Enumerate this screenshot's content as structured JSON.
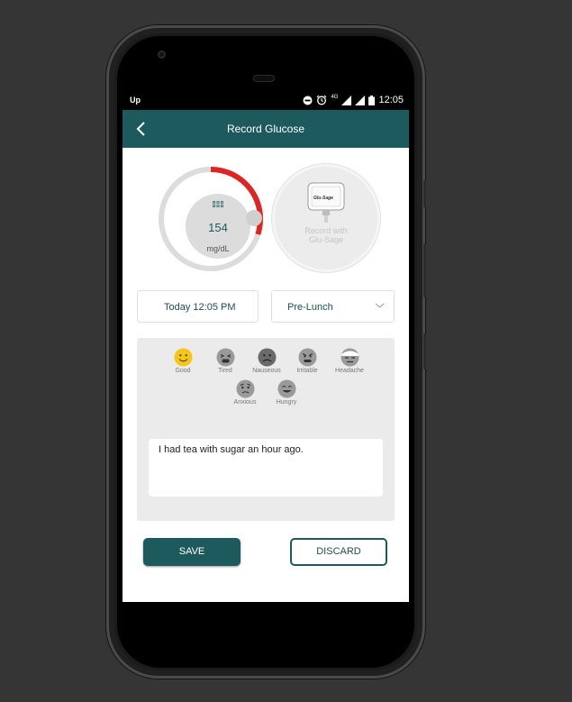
{
  "status_bar": {
    "app_badge": "Up",
    "network": "4G",
    "time": "12:05"
  },
  "app_bar": {
    "title": "Record Glucose",
    "back_icon": "chevron-left-icon"
  },
  "glucose": {
    "value": "154",
    "unit": "mg/dL",
    "level_fraction": 0.3,
    "accent_color": "#e02424",
    "track_color": "#dcdcdc"
  },
  "device": {
    "brand": "Glu-Sage",
    "label_line1": "Record with",
    "label_line2": "Glu-Sage"
  },
  "datetime": {
    "value": "Today 12:05 PM"
  },
  "meal": {
    "selected": "Pre-Lunch"
  },
  "moods": [
    {
      "label": "Good",
      "icon": "smile-icon",
      "color": "#f5c518"
    },
    {
      "label": "Tired",
      "icon": "tired-face-icon",
      "color": "#9a9a9a"
    },
    {
      "label": "Nauseous",
      "icon": "nauseous-face-icon",
      "color": "#6a6a6a"
    },
    {
      "label": "Irritable",
      "icon": "irritable-face-icon",
      "color": "#9a9a9a"
    },
    {
      "label": "Headache",
      "icon": "headache-face-icon",
      "color": "#9a9a9a"
    },
    {
      "label": "Anxious",
      "icon": "anxious-face-icon",
      "color": "#9a9a9a"
    },
    {
      "label": "Hungry",
      "icon": "hungry-face-icon",
      "color": "#9a9a9a"
    }
  ],
  "note": {
    "text": "I had tea with sugar an hour ago."
  },
  "actions": {
    "save": "SAVE",
    "discard": "DISCARD"
  },
  "colors": {
    "primary": "#1d5a5e",
    "mood_good": "#f5c518"
  }
}
